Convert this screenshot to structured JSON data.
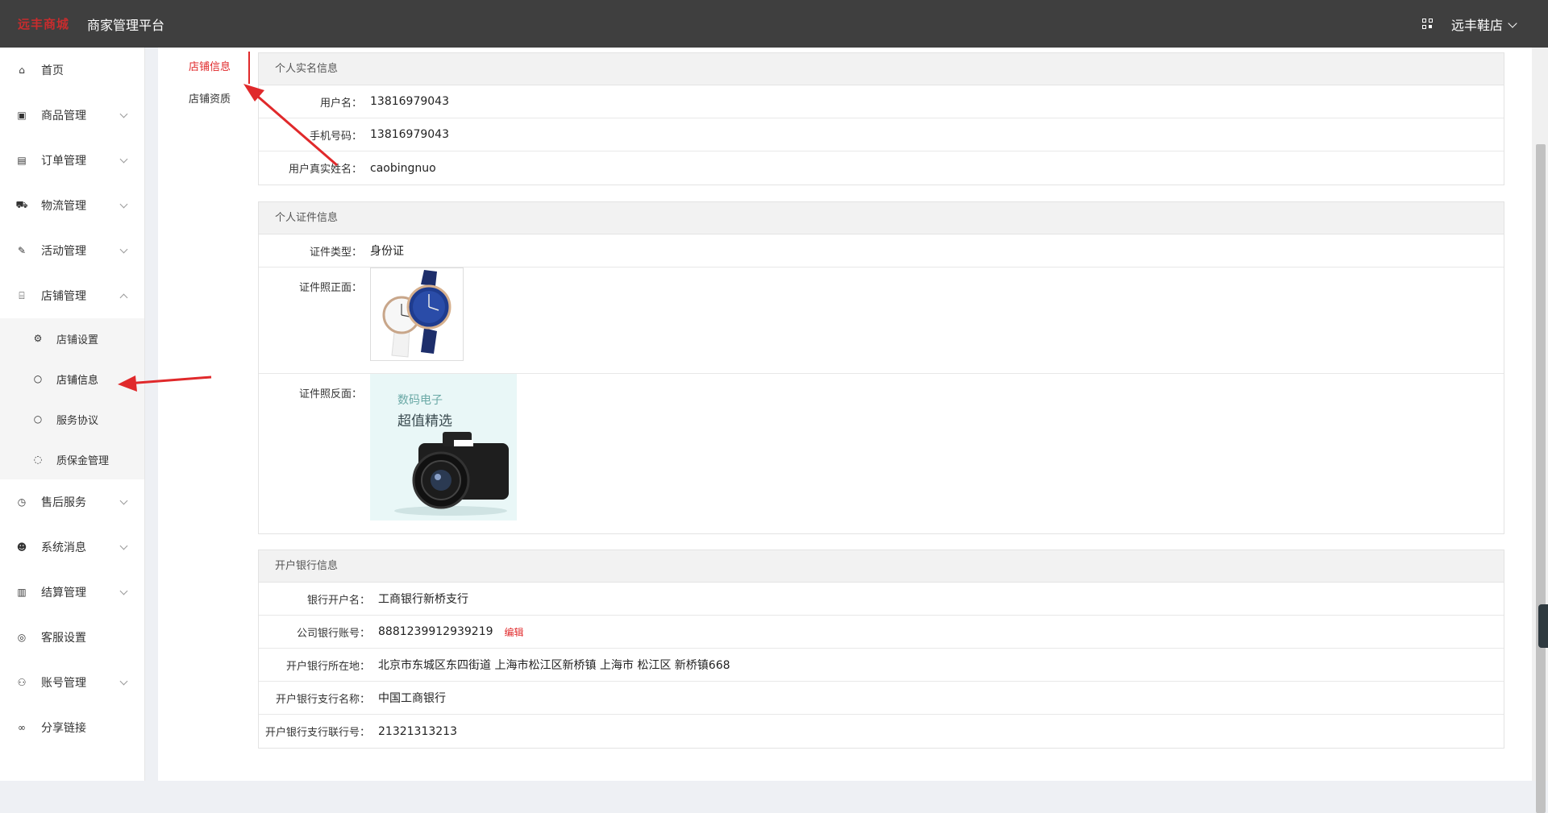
{
  "header": {
    "logo_text": "远丰商城",
    "platform_title": "商家管理平台",
    "store_name": "远丰鞋店",
    "qr_icon": "qr-code-icon"
  },
  "sidebar": {
    "items": [
      {
        "label": "首页",
        "icon": "home-icon"
      },
      {
        "label": "商品管理",
        "icon": "goods-icon"
      },
      {
        "label": "订单管理",
        "icon": "order-icon"
      },
      {
        "label": "物流管理",
        "icon": "truck-icon"
      },
      {
        "label": "活动管理",
        "icon": "tag-icon"
      },
      {
        "label": "店铺管理",
        "icon": "store-icon"
      },
      {
        "label": "售后服务",
        "icon": "service-icon"
      },
      {
        "label": "系统消息",
        "icon": "message-icon"
      },
      {
        "label": "结算管理",
        "icon": "settlement-icon"
      },
      {
        "label": "客服设置",
        "icon": "support-icon"
      },
      {
        "label": "账号管理",
        "icon": "account-icon"
      },
      {
        "label": "分享链接",
        "icon": "link-icon"
      }
    ],
    "store_sub": [
      {
        "label": "店铺设置",
        "icon": "gear-icon"
      },
      {
        "label": "店铺信息",
        "icon": "chat-icon"
      },
      {
        "label": "服务协议",
        "icon": "chat-icon"
      },
      {
        "label": "质保金管理",
        "icon": "shield-icon"
      }
    ]
  },
  "tabs": {
    "info": "店铺信息",
    "qualification": "店铺资质"
  },
  "personal": {
    "title": "个人实名信息",
    "username_label": "用户名：",
    "username": "13816979043",
    "phone_label": "手机号码：",
    "phone": "13816979043",
    "realname_label": "用户真实姓名：",
    "realname": "caobingnuo"
  },
  "id_info": {
    "title": "个人证件信息",
    "type_label": "证件类型：",
    "type": "身份证",
    "front_label": "证件照正面：",
    "back_label": "证件照反面：",
    "back_line1": "数码电子",
    "back_line2": "超值精选"
  },
  "bank": {
    "title": "开户银行信息",
    "account_name_label": "银行开户名：",
    "account_name": "工商银行新桥支行",
    "account_no_label": "公司银行账号：",
    "account_no": "8881239912939219",
    "edit_label": "编辑",
    "location_label": "开户银行所在地：",
    "location": "北京市东城区东四街道 上海市松江区新桥镇 上海市 松江区 新桥镇668",
    "branch_label": "开户银行支行名称：",
    "branch": "中国工商银行",
    "branch_no_label": "开户银行支行联行号：",
    "branch_no": "21321313213"
  }
}
